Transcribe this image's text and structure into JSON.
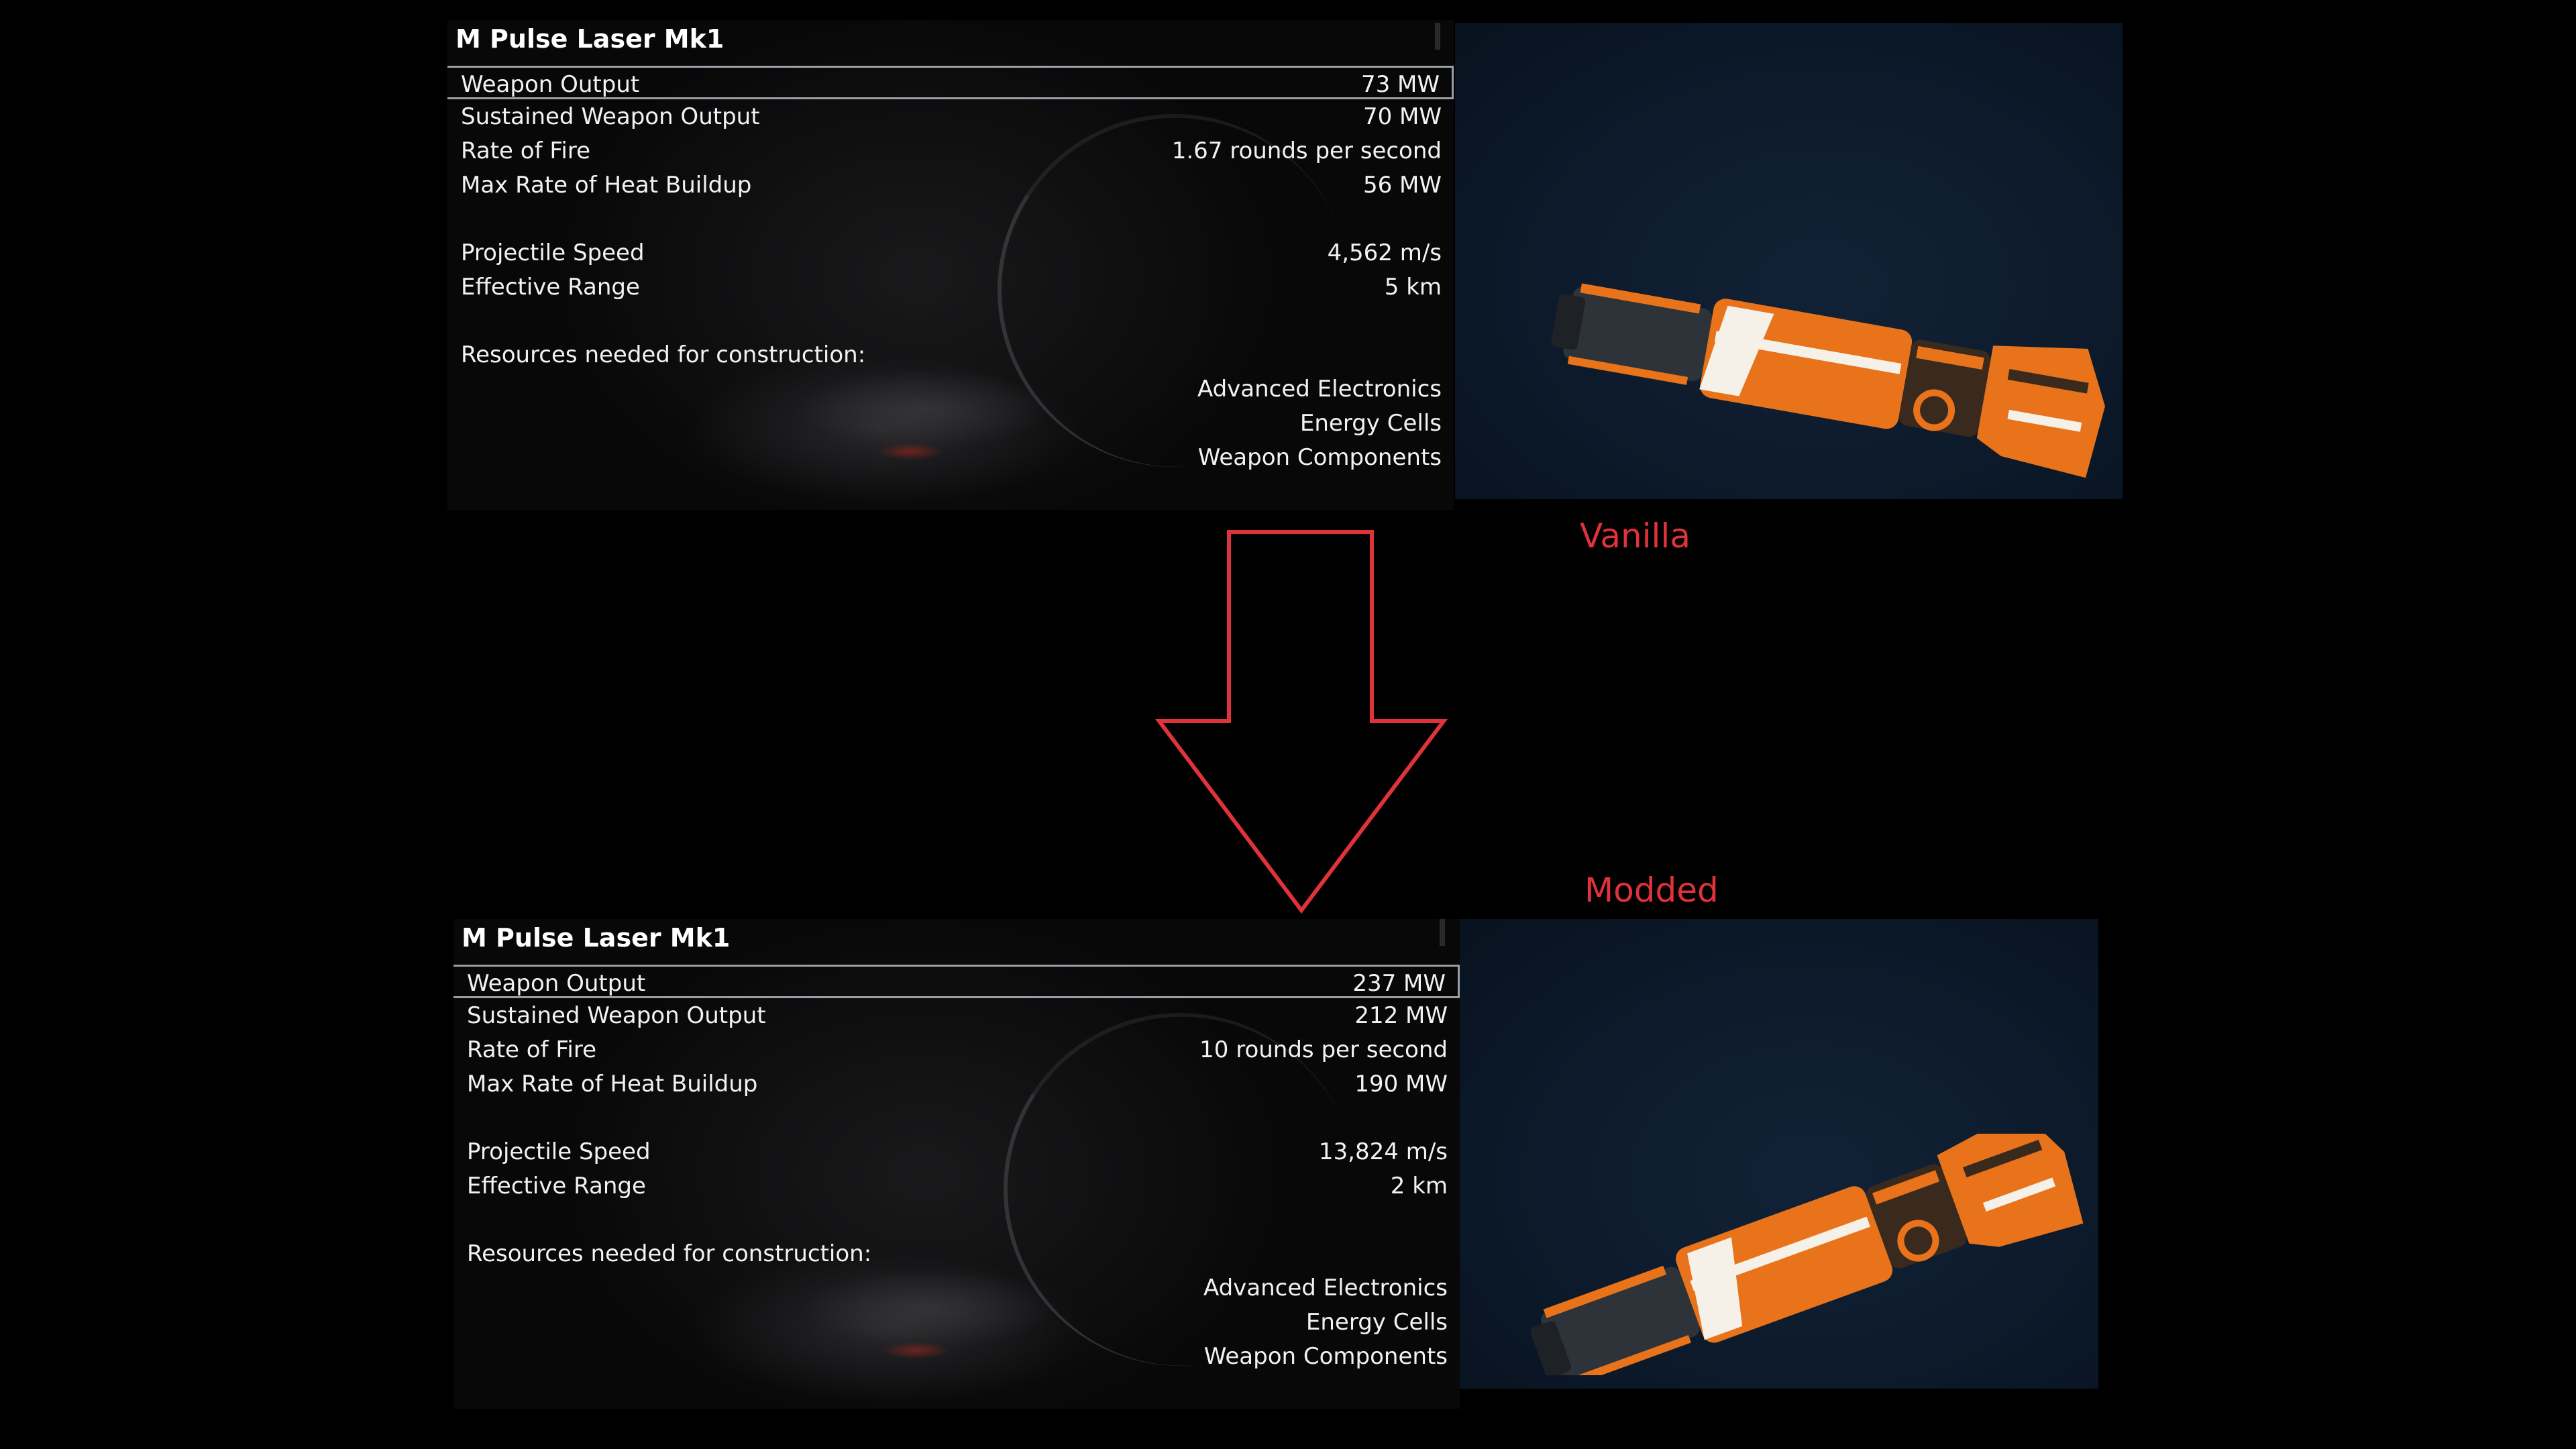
{
  "vanilla": {
    "caption": "Vanilla",
    "title": "M Pulse Laser Mk1",
    "stats": [
      {
        "label": "Weapon Output",
        "value": "73 MW"
      },
      {
        "label": "Sustained Weapon Output",
        "value": "70 MW"
      },
      {
        "label": "Rate of Fire",
        "value": "1.67 rounds per second"
      },
      {
        "label": "Max Rate of Heat Buildup",
        "value": "56 MW"
      }
    ],
    "projectile": [
      {
        "label": "Projectile Speed",
        "value": "4,562 m/s"
      },
      {
        "label": "Effective Range",
        "value": "5 km"
      }
    ],
    "resources_label": "Resources needed for construction:",
    "resources": [
      "Advanced Electronics",
      "Energy Cells",
      "Weapon Components"
    ]
  },
  "modded": {
    "caption": "Modded",
    "title": "M Pulse Laser Mk1",
    "stats": [
      {
        "label": "Weapon Output",
        "value": "237 MW"
      },
      {
        "label": "Sustained Weapon Output",
        "value": "212 MW"
      },
      {
        "label": "Rate of Fire",
        "value": "10 rounds per second"
      },
      {
        "label": "Max Rate of Heat Buildup",
        "value": "190 MW"
      }
    ],
    "projectile": [
      {
        "label": "Projectile Speed",
        "value": "13,824 m/s"
      },
      {
        "label": "Effective Range",
        "value": "2 km"
      }
    ],
    "resources_label": "Resources needed for construction:",
    "resources": [
      "Advanced Electronics",
      "Energy Cells",
      "Weapon Components"
    ]
  },
  "colors": {
    "accent": "#e0323a",
    "preview_bg": "#0c1a2b",
    "weapon_orange": "#e8731a"
  },
  "icons": {
    "arrow": "arrow-down-icon",
    "weapon": "pulse-laser-weapon-icon"
  }
}
